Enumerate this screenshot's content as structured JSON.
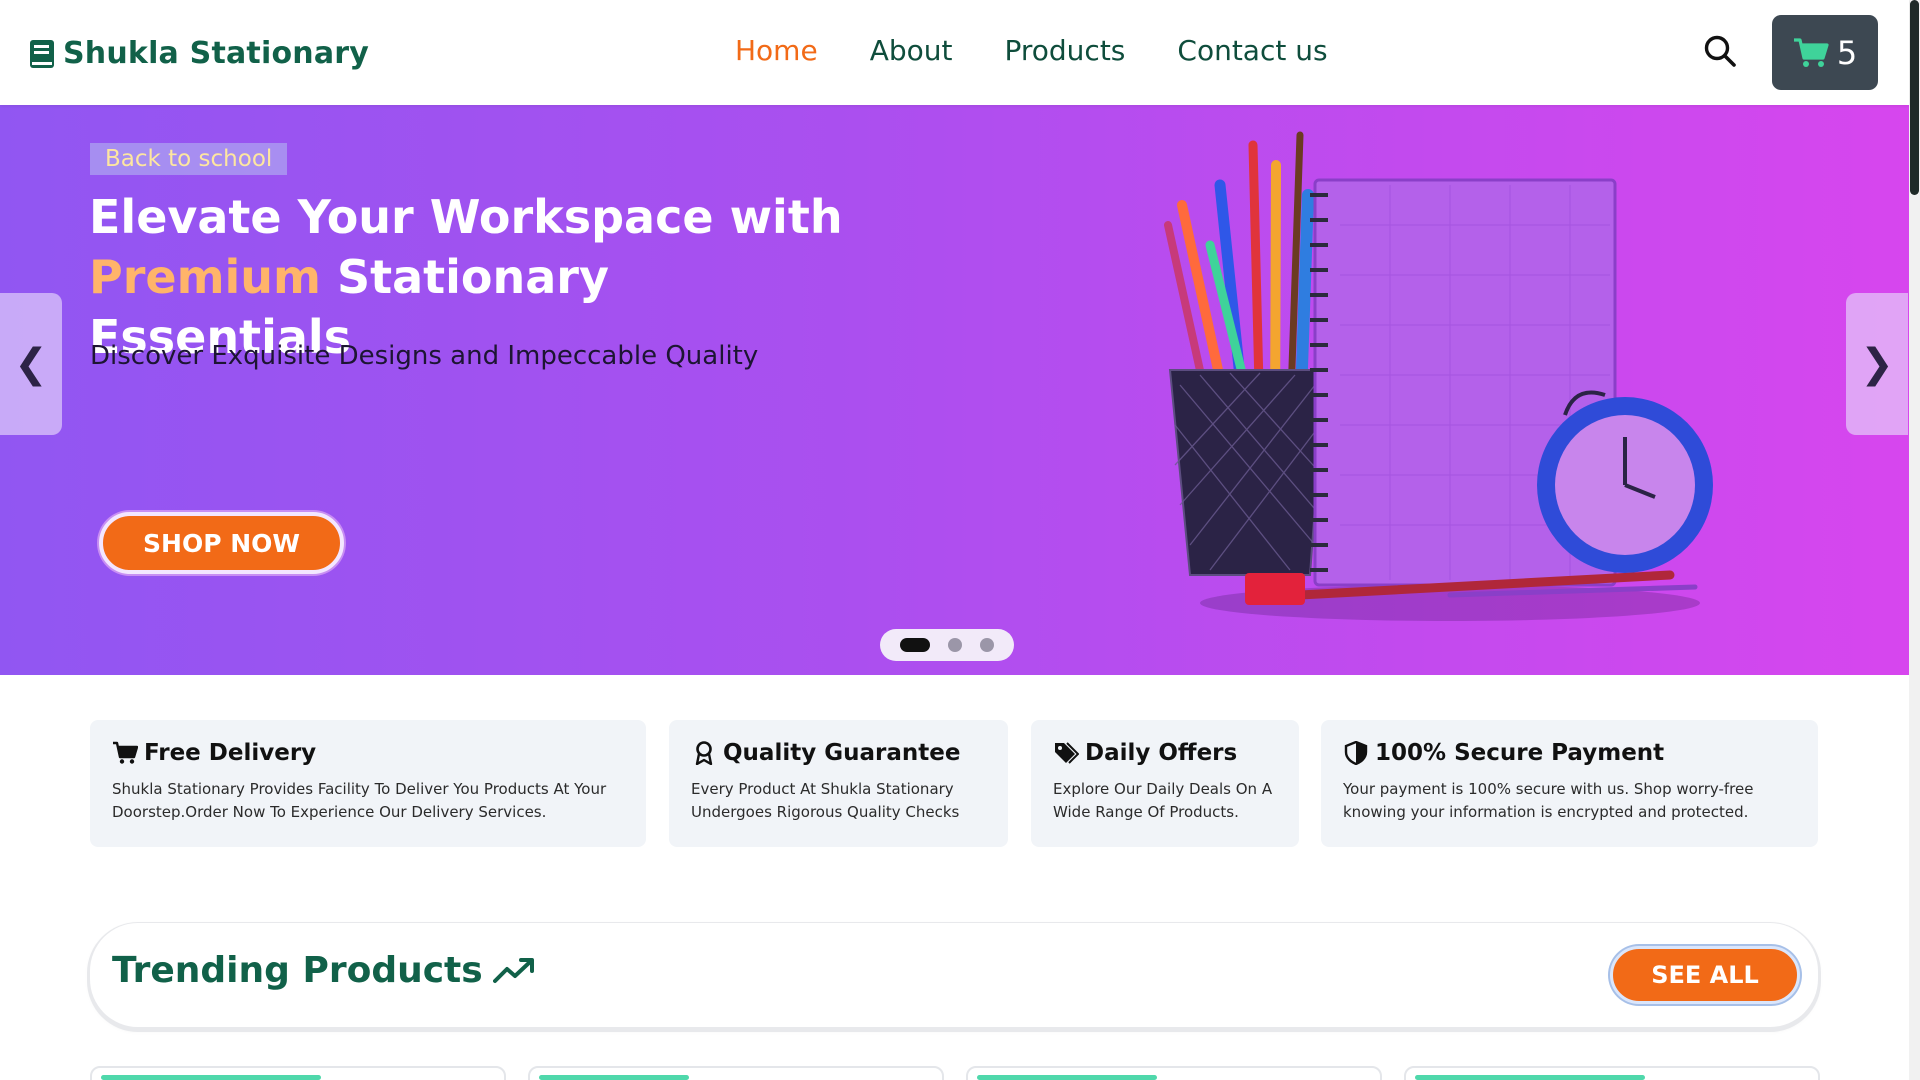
{
  "brand": {
    "name": "Shukla Stationary",
    "icon": "book-icon"
  },
  "nav": {
    "items": [
      {
        "label": "Home",
        "active": true
      },
      {
        "label": "About",
        "active": false
      },
      {
        "label": "Products",
        "active": false
      },
      {
        "label": "Contact us",
        "active": false
      }
    ]
  },
  "header": {
    "search_icon": "search-icon",
    "cart_icon": "cart-icon",
    "cart_count": "5"
  },
  "hero": {
    "badge": "Back to school",
    "title_line1": "Elevate Your Workspace with",
    "title_accent": "Premium",
    "title_line2_rest": "Stationary Essentials",
    "subtitle": "Discover Exquisite Designs and Impeccable Quality",
    "cta": "SHOP NOW",
    "prev": "❮",
    "next": "❯",
    "slides_total": 3,
    "active_slide": 1
  },
  "features": [
    {
      "icon": "cart-icon",
      "title": "Free Delivery",
      "text": "Shukla Stationary Provides Facility To Deliver You Products At Your Doorstep.Order Now To Experience Our Delivery Services."
    },
    {
      "icon": "award-icon",
      "title": "Quality Guarantee",
      "text": "Every Product At Shukla Stationary Undergoes Rigorous Quality Checks"
    },
    {
      "icon": "tags-icon",
      "title": "Daily Offers",
      "text": "Explore Our Daily Deals On A Wide Range Of Products."
    },
    {
      "icon": "shield-icon",
      "title": "100% Secure Payment",
      "text": "Your payment is 100% secure with us. Shop worry-free knowing your information is encrypted and protected."
    }
  ],
  "trending": {
    "title": "Trending Products",
    "icon": "trending-up-icon",
    "see_all": "SEE ALL"
  },
  "colors": {
    "brand_green": "#116149",
    "accent_orange": "#f26a17",
    "hero_start": "#9156f2",
    "hero_end": "#d746ee",
    "cart_bg": "#3d4852"
  }
}
